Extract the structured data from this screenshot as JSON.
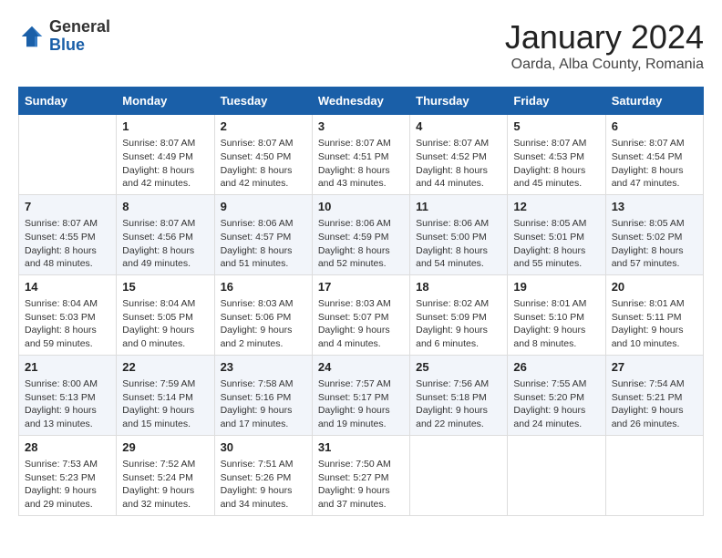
{
  "header": {
    "logo_general": "General",
    "logo_blue": "Blue",
    "month_title": "January 2024",
    "location": "Oarda, Alba County, Romania"
  },
  "days_of_week": [
    "Sunday",
    "Monday",
    "Tuesday",
    "Wednesday",
    "Thursday",
    "Friday",
    "Saturday"
  ],
  "weeks": [
    [
      {
        "day": "",
        "info": ""
      },
      {
        "day": "1",
        "info": "Sunrise: 8:07 AM\nSunset: 4:49 PM\nDaylight: 8 hours\nand 42 minutes."
      },
      {
        "day": "2",
        "info": "Sunrise: 8:07 AM\nSunset: 4:50 PM\nDaylight: 8 hours\nand 42 minutes."
      },
      {
        "day": "3",
        "info": "Sunrise: 8:07 AM\nSunset: 4:51 PM\nDaylight: 8 hours\nand 43 minutes."
      },
      {
        "day": "4",
        "info": "Sunrise: 8:07 AM\nSunset: 4:52 PM\nDaylight: 8 hours\nand 44 minutes."
      },
      {
        "day": "5",
        "info": "Sunrise: 8:07 AM\nSunset: 4:53 PM\nDaylight: 8 hours\nand 45 minutes."
      },
      {
        "day": "6",
        "info": "Sunrise: 8:07 AM\nSunset: 4:54 PM\nDaylight: 8 hours\nand 47 minutes."
      }
    ],
    [
      {
        "day": "7",
        "info": "Sunrise: 8:07 AM\nSunset: 4:55 PM\nDaylight: 8 hours\nand 48 minutes."
      },
      {
        "day": "8",
        "info": "Sunrise: 8:07 AM\nSunset: 4:56 PM\nDaylight: 8 hours\nand 49 minutes."
      },
      {
        "day": "9",
        "info": "Sunrise: 8:06 AM\nSunset: 4:57 PM\nDaylight: 8 hours\nand 51 minutes."
      },
      {
        "day": "10",
        "info": "Sunrise: 8:06 AM\nSunset: 4:59 PM\nDaylight: 8 hours\nand 52 minutes."
      },
      {
        "day": "11",
        "info": "Sunrise: 8:06 AM\nSunset: 5:00 PM\nDaylight: 8 hours\nand 54 minutes."
      },
      {
        "day": "12",
        "info": "Sunrise: 8:05 AM\nSunset: 5:01 PM\nDaylight: 8 hours\nand 55 minutes."
      },
      {
        "day": "13",
        "info": "Sunrise: 8:05 AM\nSunset: 5:02 PM\nDaylight: 8 hours\nand 57 minutes."
      }
    ],
    [
      {
        "day": "14",
        "info": "Sunrise: 8:04 AM\nSunset: 5:03 PM\nDaylight: 8 hours\nand 59 minutes."
      },
      {
        "day": "15",
        "info": "Sunrise: 8:04 AM\nSunset: 5:05 PM\nDaylight: 9 hours\nand 0 minutes."
      },
      {
        "day": "16",
        "info": "Sunrise: 8:03 AM\nSunset: 5:06 PM\nDaylight: 9 hours\nand 2 minutes."
      },
      {
        "day": "17",
        "info": "Sunrise: 8:03 AM\nSunset: 5:07 PM\nDaylight: 9 hours\nand 4 minutes."
      },
      {
        "day": "18",
        "info": "Sunrise: 8:02 AM\nSunset: 5:09 PM\nDaylight: 9 hours\nand 6 minutes."
      },
      {
        "day": "19",
        "info": "Sunrise: 8:01 AM\nSunset: 5:10 PM\nDaylight: 9 hours\nand 8 minutes."
      },
      {
        "day": "20",
        "info": "Sunrise: 8:01 AM\nSunset: 5:11 PM\nDaylight: 9 hours\nand 10 minutes."
      }
    ],
    [
      {
        "day": "21",
        "info": "Sunrise: 8:00 AM\nSunset: 5:13 PM\nDaylight: 9 hours\nand 13 minutes."
      },
      {
        "day": "22",
        "info": "Sunrise: 7:59 AM\nSunset: 5:14 PM\nDaylight: 9 hours\nand 15 minutes."
      },
      {
        "day": "23",
        "info": "Sunrise: 7:58 AM\nSunset: 5:16 PM\nDaylight: 9 hours\nand 17 minutes."
      },
      {
        "day": "24",
        "info": "Sunrise: 7:57 AM\nSunset: 5:17 PM\nDaylight: 9 hours\nand 19 minutes."
      },
      {
        "day": "25",
        "info": "Sunrise: 7:56 AM\nSunset: 5:18 PM\nDaylight: 9 hours\nand 22 minutes."
      },
      {
        "day": "26",
        "info": "Sunrise: 7:55 AM\nSunset: 5:20 PM\nDaylight: 9 hours\nand 24 minutes."
      },
      {
        "day": "27",
        "info": "Sunrise: 7:54 AM\nSunset: 5:21 PM\nDaylight: 9 hours\nand 26 minutes."
      }
    ],
    [
      {
        "day": "28",
        "info": "Sunrise: 7:53 AM\nSunset: 5:23 PM\nDaylight: 9 hours\nand 29 minutes."
      },
      {
        "day": "29",
        "info": "Sunrise: 7:52 AM\nSunset: 5:24 PM\nDaylight: 9 hours\nand 32 minutes."
      },
      {
        "day": "30",
        "info": "Sunrise: 7:51 AM\nSunset: 5:26 PM\nDaylight: 9 hours\nand 34 minutes."
      },
      {
        "day": "31",
        "info": "Sunrise: 7:50 AM\nSunset: 5:27 PM\nDaylight: 9 hours\nand 37 minutes."
      },
      {
        "day": "",
        "info": ""
      },
      {
        "day": "",
        "info": ""
      },
      {
        "day": "",
        "info": ""
      }
    ]
  ]
}
